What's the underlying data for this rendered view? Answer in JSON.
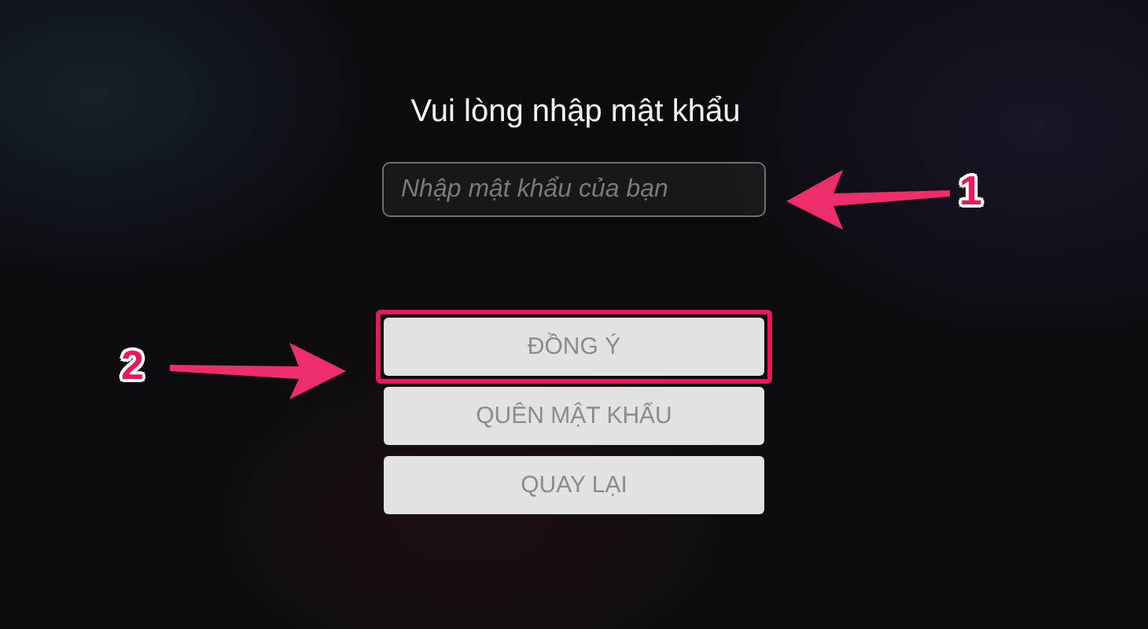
{
  "title": "Vui lòng nhập mật khẩu",
  "password_field": {
    "placeholder": "Nhập mật khẩu của bạn"
  },
  "buttons": [
    {
      "label": "ĐỒNG Ý",
      "highlighted": true
    },
    {
      "label": "QUÊN MẬT KHẨU",
      "highlighted": false
    },
    {
      "label": "QUAY LẠI",
      "highlighted": false
    }
  ],
  "annotations": [
    {
      "label": "1",
      "kind": "field"
    },
    {
      "label": "2",
      "kind": "button"
    }
  ]
}
